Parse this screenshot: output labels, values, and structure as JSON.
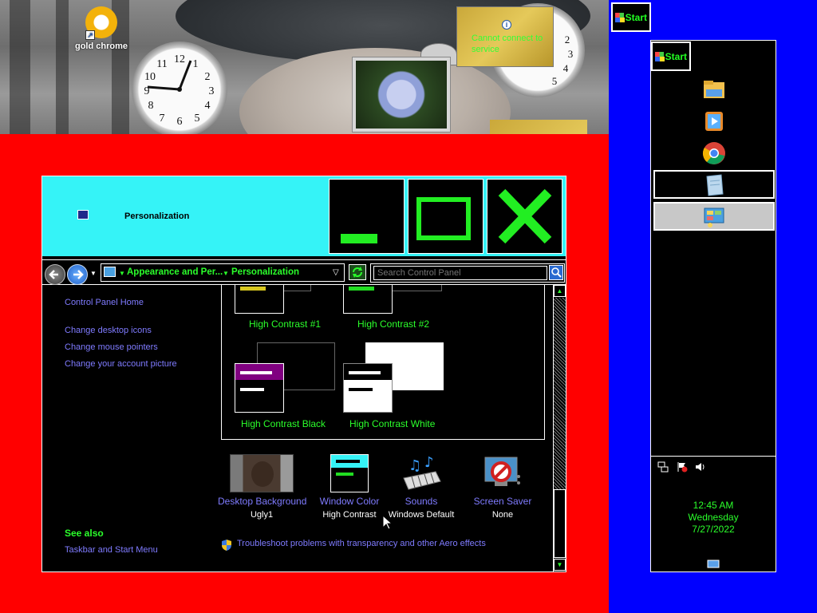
{
  "desktop": {
    "icons": [
      {
        "label": "gold chrome",
        "icon": "chrome-shortcut-icon"
      }
    ],
    "gadgets": {
      "info_text": "Cannot connect to service",
      "info_icon": "info-icon"
    }
  },
  "window": {
    "title": "Personalization",
    "title_icon": "personalization-icon",
    "caption_buttons": [
      {
        "name": "minimize",
        "icon": "minimize-icon"
      },
      {
        "name": "maximize",
        "icon": "maximize-icon"
      },
      {
        "name": "close",
        "icon": "close-icon"
      }
    ],
    "address": {
      "breadcrumbs": [
        "Appearance and Per...",
        "Personalization"
      ],
      "search_placeholder": "Search Control Panel"
    },
    "sidebar": {
      "home": "Control Panel Home",
      "links": [
        "Change desktop icons",
        "Change mouse pointers",
        "Change your account picture"
      ],
      "see_also_heading": "See also",
      "see_also_links": [
        "Taskbar and Start Menu"
      ]
    },
    "themes": [
      {
        "label": "High Contrast #1",
        "accent": "#d8c820"
      },
      {
        "label": "High Contrast #2",
        "accent": "#22dd22"
      },
      {
        "label": "High Contrast Black",
        "accent": "#800080"
      },
      {
        "label": "High Contrast White",
        "accent": "#000000"
      }
    ],
    "bottom_items": [
      {
        "label": "Desktop Background",
        "value": "Ugly1",
        "icon": "desktop-background-icon"
      },
      {
        "label": "Window Color",
        "value": "High Contrast",
        "icon": "window-color-icon"
      },
      {
        "label": "Sounds",
        "value": "Windows Default",
        "icon": "sounds-icon"
      },
      {
        "label": "Screen Saver",
        "value": "None",
        "icon": "screen-saver-icon"
      }
    ],
    "troubleshoot": "Troubleshoot problems with transparency and other Aero effects"
  },
  "taskbar": {
    "start_label": "Start",
    "apps": [
      "file-explorer-icon",
      "media-player-icon",
      "chrome-icon",
      "notepad-icon",
      "control-panel-icon"
    ],
    "tray_icons": [
      "network-icon",
      "action-center-icon",
      "volume-icon"
    ],
    "clock": {
      "time": "12:45 AM",
      "day": "Wednesday",
      "date": "7/27/2022"
    },
    "show_desktop_icon": "show-desktop-icon"
  },
  "colors": {
    "accent_green": "#2bff2b",
    "link_purple": "#7f7bff",
    "title_cyan": "#35f3f7",
    "red_bg": "#ff0000",
    "blue_bg": "#0000ff"
  }
}
